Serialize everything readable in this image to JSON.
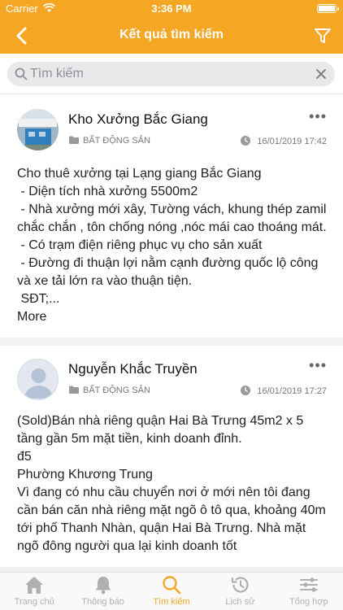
{
  "status_bar": {
    "carrier": "Carrier",
    "time": "3:36 PM"
  },
  "nav": {
    "title": "Kết quả tìm kiếm",
    "back_icon": "chevron-left-icon",
    "filter_icon": "filter-icon"
  },
  "search": {
    "placeholder": "Tìm kiếm",
    "value": ""
  },
  "posts": [
    {
      "title": "Kho Xưởng Bắc Giang",
      "category": "BẤT ĐỘNG SẢN",
      "timestamp": "16/01/2019 17:42",
      "content": "Cho thuê xưởng tại Lạng giang Bắc Giang\n - Diện tích nhà xưởng 5500m2\n - Nhà xưởng mới xây, Tường vách, khung thép zamil chắc chắn , tôn chống nóng ,nóc mái cao thoáng mát.\n - Có trạm điện riêng phục vụ cho sản xuất\n - Đường đi thuận lợi nằm cạnh đường quốc lộ công và xe tải lớn ra vào thuận tiện.\n SĐT;...",
      "more_label": "More"
    },
    {
      "title": "Nguyễn Khắc Truyền",
      "category": "BẤT ĐỘNG SẢN",
      "timestamp": "16/01/2019 17:27",
      "content": "(Sold)Bán nhà riêng quận Hai Bà Trưng 45m2 x 5 tầng gần 5m mặt tiền, kinh doanh đỉnh.\nđ5\nPhường Khương Trung\nVì đang có nhu cầu chuyển nơi ở mới nên tôi đang cần bán căn nhà riêng mặt ngõ ô tô qua, khoảng 40m tới phố Thanh Nhàn, quận Hai Bà Trưng. Nhà mặt ngõ đông người qua lại kinh doanh tốt"
    }
  ],
  "tabs": [
    {
      "label": "Trang chủ",
      "icon": "home-icon"
    },
    {
      "label": "Thông báo",
      "icon": "bell-icon"
    },
    {
      "label": "Tìm kiếm",
      "icon": "search-icon",
      "active": true
    },
    {
      "label": "Lịch sử",
      "icon": "history-icon"
    },
    {
      "label": "Tổng hợp",
      "icon": "sliders-icon"
    }
  ],
  "colors": {
    "accent": "#f5a623",
    "tab_inactive": "#b0b0b0"
  }
}
